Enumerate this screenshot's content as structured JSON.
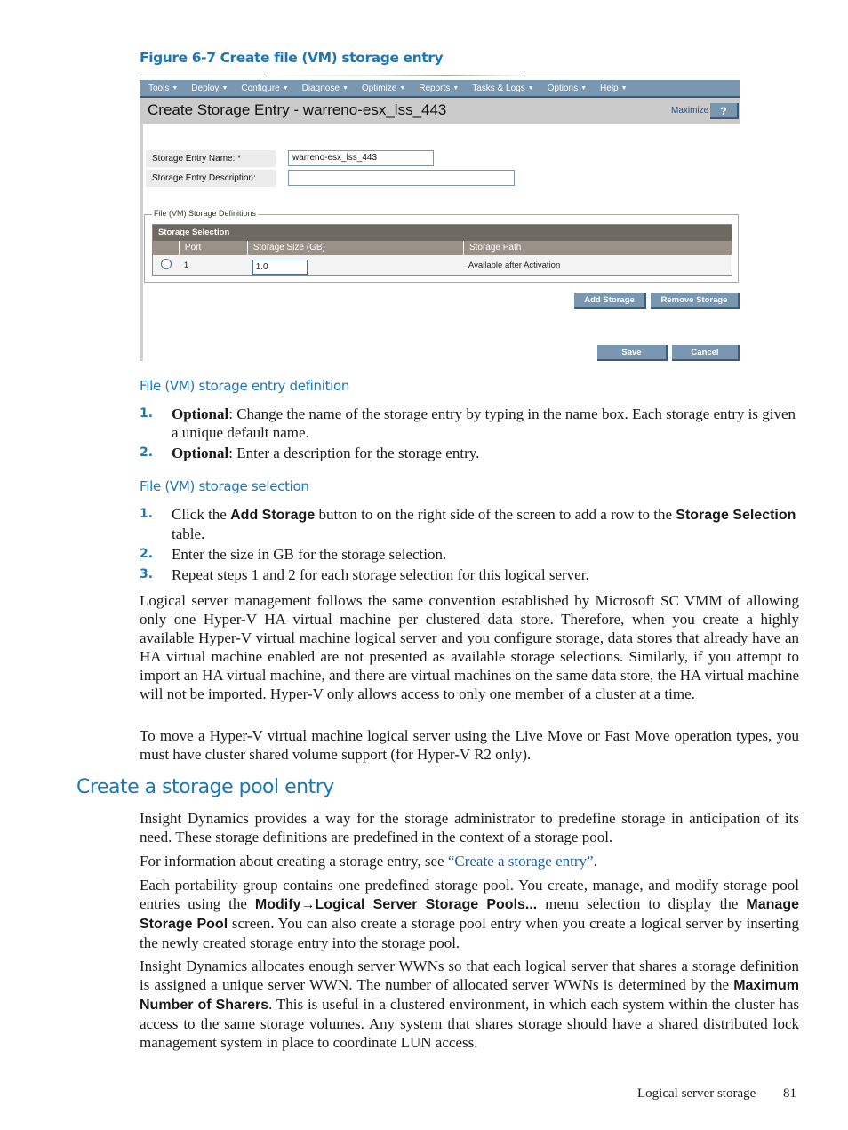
{
  "figure": {
    "caption": "Figure 6-7 Create file (VM) storage entry",
    "screenshot": {
      "menu": [
        {
          "label": "Tools"
        },
        {
          "label": "Deploy"
        },
        {
          "label": "Configure"
        },
        {
          "label": "Diagnose"
        },
        {
          "label": "Optimize"
        },
        {
          "label": "Reports"
        },
        {
          "label": "Tasks & Logs"
        },
        {
          "label": "Options"
        },
        {
          "label": "Help"
        }
      ],
      "title": "Create Storage Entry - warreno-esx_lss_443",
      "maximize_label": "Maximize",
      "help_label": "?",
      "fields": {
        "name_label": "Storage Entry Name: *",
        "name_value": "warreno-esx_lss_443",
        "description_label": "Storage Entry Description:",
        "description_value": ""
      },
      "fieldset_legend": "File (VM) Storage Definitions",
      "table": {
        "caption": "Storage Selection",
        "columns": [
          "",
          "Port",
          "Storage Size (GB)",
          "Storage Path"
        ],
        "rows": [
          {
            "port": "1",
            "size": "1.0",
            "path": "Available after Activation"
          }
        ]
      },
      "buttons": {
        "add_storage": "Add Storage",
        "remove_storage": "Remove Storage",
        "save": "Save",
        "cancel": "Cancel"
      }
    }
  },
  "definition": {
    "heading": "File (VM) storage entry definition",
    "items": [
      {
        "num": "1.",
        "bold": "Optional",
        "text": ": Change the name of the storage entry by typing in the name box. Each storage entry is given a unique default name."
      },
      {
        "num": "2.",
        "bold": "Optional",
        "text": ": Enter a description for the storage entry."
      }
    ]
  },
  "selection": {
    "heading": "File (VM) storage selection",
    "items": [
      {
        "num": "1.",
        "pre": "Click the ",
        "b1": "Add Storage",
        "mid": " button to on the right side of the screen to add a row to the ",
        "b2": "Storage Selection",
        "post": " table."
      },
      {
        "num": "2.",
        "text": "Enter the size in GB for the storage selection."
      },
      {
        "num": "3.",
        "text": "Repeat steps 1 and 2 for each storage selection for this logical server."
      }
    ]
  },
  "paragraphs": {
    "p1": "Logical server management follows the same convention established by Microsoft SC VMM of allowing only one Hyper-V HA virtual machine per clustered data store. Therefore, when you create a highly available Hyper-V virtual machine logical server and you configure storage, data stores that already have an HA virtual machine enabled are not presented as available storage selections. Similarly, if you attempt to import an HA virtual machine, and there are virtual machines on the same data store, the HA virtual machine will not be imported. Hyper-V only allows access to only one member of a cluster at a time.",
    "p2": "To move a Hyper-V virtual machine logical server using the Live Move or Fast Move operation types, you must have cluster shared volume support (for Hyper-V R2 only)."
  },
  "pool_section": {
    "title": "Create a storage pool entry",
    "p1": "Insight Dynamics provides a way for the storage administrator to predefine storage in anticipation of its need. These storage definitions are predefined in the context of a storage pool.",
    "p2_pre": "For information about creating a storage entry, see ",
    "p2_link": "“Create a storage entry”",
    "p2_post": ".",
    "p3_a": "Each portability group contains one predefined storage pool. You create, manage, and modify storage pool entries using the ",
    "p3_b1": "Modify→Logical Server Storage Pools...",
    "p3_c": " menu selection to display the ",
    "p3_b2": "Manage Storage Pool",
    "p3_d": "  screen. You can also create a storage pool entry when you create a logical server by inserting the newly created storage entry into the storage pool.",
    "p4_a": "Insight Dynamics allocates enough server WWNs so that each logical server that shares a storage definition is assigned a unique server WWN. The number of allocated server WWNs is determined by the ",
    "p4_b": "Maximum Number of Sharers",
    "p4_c": ". This is useful in a clustered environment, in which each system within the cluster has access to the same storage volumes. Any system that shares storage should have a shared distributed lock management system in place to coordinate LUN access."
  },
  "footer": {
    "section": "Logical server storage",
    "page": "81"
  }
}
